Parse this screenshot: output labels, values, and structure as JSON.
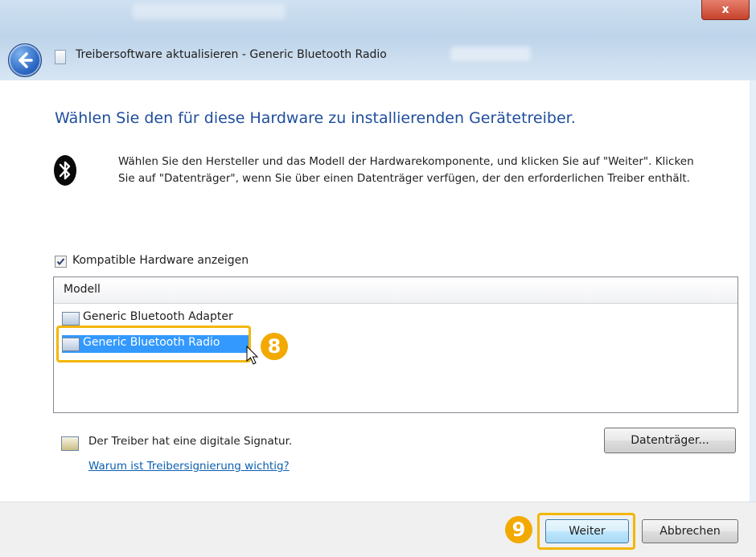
{
  "window": {
    "title": "Treibersoftware aktualisieren - Generic Bluetooth Radio",
    "close_label": "x"
  },
  "heading": "Wählen Sie den für diese Hardware zu installierenden Gerätetreiber.",
  "description": "Wählen Sie den Hersteller und das Modell der Hardwarekomponente, und klicken Sie auf \"Weiter\". Klicken Sie auf \"Datenträger\", wenn Sie über einen Datenträger verfügen, der den erforderlichen Treiber enthält.",
  "compatible_checkbox": {
    "label": "Kompatible Hardware anzeigen",
    "checked": true
  },
  "model_list": {
    "header": "Modell",
    "items": [
      {
        "label": "Generic Bluetooth Adapter",
        "selected": false
      },
      {
        "label": "Generic Bluetooth Radio",
        "selected": true
      }
    ]
  },
  "signature": {
    "text": "Der Treiber hat eine digitale Signatur.",
    "link": "Warum ist Treibersignierung wichtig?"
  },
  "buttons": {
    "datentraeger": "Datenträger...",
    "weiter": "Weiter",
    "abbrechen": "Abbrechen"
  },
  "annotations": {
    "step_8": "8",
    "step_9": "9",
    "highlight_color": "#f2b705"
  },
  "colors": {
    "heading": "#1f4e9c",
    "selection": "#3399ff",
    "link": "#0b5fb0"
  }
}
